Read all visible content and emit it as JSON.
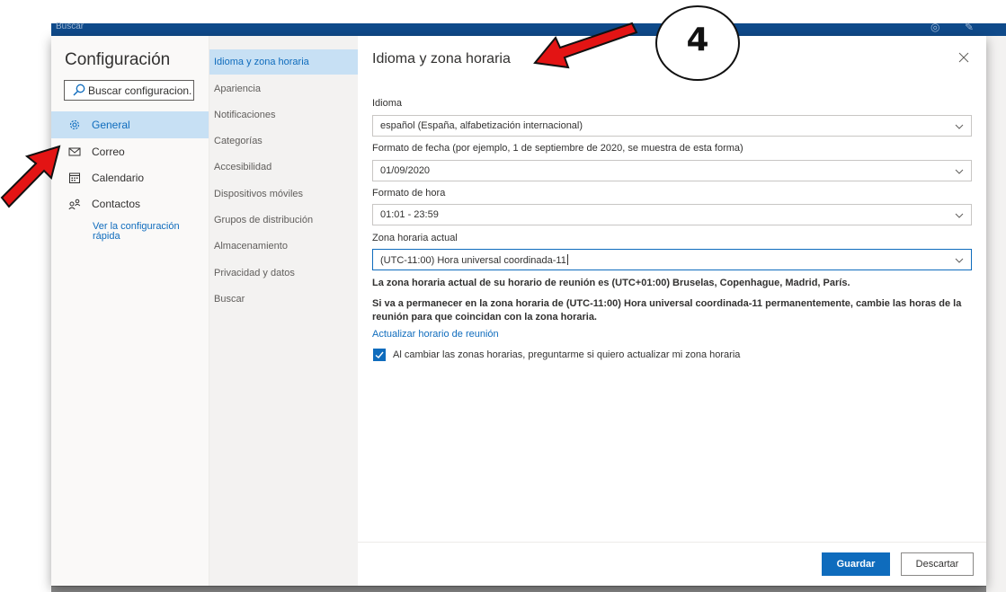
{
  "background_app": {
    "search_label": "Buscar"
  },
  "settings": {
    "title": "Configuración",
    "search": {
      "placeholder": "Buscar configuracion..."
    },
    "nav": [
      {
        "label": "General",
        "icon": "gear-icon",
        "active": true
      },
      {
        "label": "Correo",
        "icon": "mail-icon"
      },
      {
        "label": "Calendario",
        "icon": "calendar-icon"
      },
      {
        "label": "Contactos",
        "icon": "people-icon"
      }
    ],
    "quick_link": "Ver la configuración rápida",
    "subnav": [
      {
        "label": "Idioma y zona horaria",
        "active": true
      },
      {
        "label": "Apariencia"
      },
      {
        "label": "Notificaciones"
      },
      {
        "label": "Categorías"
      },
      {
        "label": "Accesibilidad"
      },
      {
        "label": "Dispositivos móviles"
      },
      {
        "label": "Grupos de distribución"
      },
      {
        "label": "Almacenamiento"
      },
      {
        "label": "Privacidad y datos"
      },
      {
        "label": "Buscar"
      }
    ]
  },
  "pane": {
    "title": "Idioma y zona horaria",
    "language": {
      "label": "Idioma",
      "value": "español (España, alfabetización internacional)"
    },
    "date_format": {
      "label": "Formato de fecha (por ejemplo, 1 de septiembre de 2020, se muestra de esta forma)",
      "value": "01/09/2020"
    },
    "time_format": {
      "label": "Formato de hora",
      "value": "01:01 - 23:59"
    },
    "timezone": {
      "label": "Zona horaria actual",
      "value": "(UTC-11:00) Hora universal coordinada-11"
    },
    "info_meeting_tz": "La zona horaria actual de su horario de reunión es (UTC+01:00) Bruselas, Copenhague, Madrid, París.",
    "info_permanent": "Si va a permanecer en la zona horaria de (UTC-11:00) Hora universal coordinada-11 permanentemente, cambie las horas de la reunión para que coincidan con la zona horaria.",
    "update_link": "Actualizar horario de reunión",
    "ask_checkbox": {
      "label": "Al cambiar las zonas horarias, preguntarme si quiero actualizar mi zona horaria",
      "checked": true
    },
    "save_label": "Guardar",
    "discard_label": "Descartar"
  },
  "annotation": {
    "step_number": "4",
    "arrow_color": "#e31414"
  },
  "colors": {
    "accent": "#0f6cbd",
    "selected_bg": "#c7e0f4",
    "header_blue": "#0f4a8a"
  }
}
